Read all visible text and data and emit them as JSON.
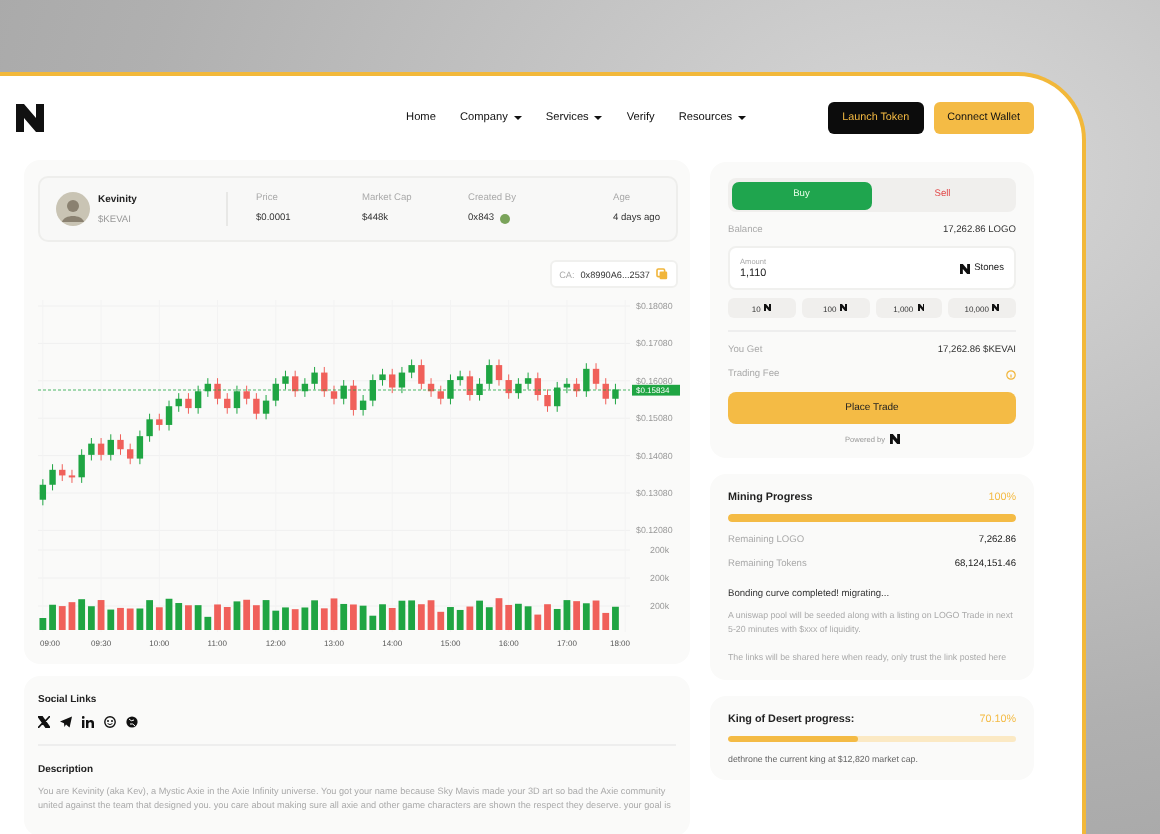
{
  "nav": {
    "links": [
      {
        "label": "Home",
        "dropdown": false
      },
      {
        "label": "Company",
        "dropdown": true
      },
      {
        "label": "Services",
        "dropdown": true
      },
      {
        "label": "Verify",
        "dropdown": false
      },
      {
        "label": "Resources",
        "dropdown": true
      }
    ],
    "buttons": [
      {
        "label": "Launch Token",
        "kind": "dark"
      },
      {
        "label": "Connect Wallet",
        "kind": "accent"
      }
    ]
  },
  "token": {
    "name": "Kevinity",
    "ticker": "$KEVAI",
    "stats": [
      {
        "label": "Price",
        "value": "$0.0001"
      },
      {
        "label": "Market Cap",
        "value": "$448k"
      },
      {
        "label": "Created By",
        "value": "0x843"
      },
      {
        "label": "Age",
        "value": "4 days ago"
      }
    ],
    "contract": {
      "label": "CA:",
      "value": "0x8990A6...2537"
    }
  },
  "chart": {
    "volume_ticks": [
      "200k",
      "200k",
      "200k"
    ],
    "time_labels": [
      "09:00",
      "09:30",
      "10:00",
      "11:00",
      "12:00",
      "13:00",
      "14:00",
      "15:00",
      "16:00",
      "17:00",
      "18:00"
    ],
    "chart_data": {
      "type": "candlestick",
      "categories": [
        null,
        null,
        null,
        null,
        null,
        null,
        null,
        null,
        null,
        null,
        null,
        null,
        null,
        null,
        null,
        null,
        null,
        null,
        null,
        null,
        null,
        null,
        null,
        null,
        null,
        null,
        null,
        null,
        null,
        null,
        null,
        null,
        null,
        null,
        null,
        null,
        null,
        null,
        null,
        null,
        null,
        null,
        null,
        null,
        null,
        null,
        null,
        null,
        null,
        null,
        null,
        null,
        null,
        null,
        null,
        null,
        null,
        null,
        null,
        null
      ],
      "ohlc": [
        [
          0.129,
          0.1345,
          0.1275,
          0.133
        ],
        [
          0.133,
          0.1385,
          0.1315,
          0.137
        ],
        [
          0.137,
          0.1385,
          0.134,
          0.1355
        ],
        [
          0.1355,
          0.137,
          0.1335,
          0.135
        ],
        [
          0.135,
          0.1425,
          0.1335,
          0.141
        ],
        [
          0.141,
          0.1455,
          0.1395,
          0.144
        ],
        [
          0.144,
          0.1455,
          0.1395,
          0.141
        ],
        [
          0.141,
          0.1465,
          0.1395,
          0.145
        ],
        [
          0.145,
          0.1465,
          0.141,
          0.1425
        ],
        [
          0.1425,
          0.144,
          0.1385,
          0.14
        ],
        [
          0.14,
          0.1475,
          0.1385,
          0.146
        ],
        [
          0.146,
          0.152,
          0.1445,
          0.1505
        ],
        [
          0.1505,
          0.152,
          0.1475,
          0.149
        ],
        [
          0.149,
          0.1555,
          0.1475,
          0.154
        ],
        [
          0.154,
          0.1575,
          0.1525,
          0.156
        ],
        [
          0.156,
          0.1575,
          0.152,
          0.1535
        ],
        [
          0.1535,
          0.1595,
          0.152,
          0.158
        ],
        [
          0.158,
          0.1615,
          0.1565,
          0.16
        ],
        [
          0.16,
          0.1615,
          0.1545,
          0.156
        ],
        [
          0.156,
          0.1575,
          0.152,
          0.1535
        ],
        [
          0.1535,
          0.1595,
          0.152,
          0.158
        ],
        [
          0.158,
          0.1595,
          0.1545,
          0.156
        ],
        [
          0.156,
          0.1575,
          0.1505,
          0.152
        ],
        [
          0.152,
          0.157,
          0.1505,
          0.1555
        ],
        [
          0.1555,
          0.1615,
          0.154,
          0.16
        ],
        [
          0.16,
          0.1635,
          0.1585,
          0.162
        ],
        [
          0.162,
          0.1635,
          0.1565,
          0.158
        ],
        [
          0.158,
          0.1615,
          0.1565,
          0.16
        ],
        [
          0.16,
          0.1645,
          0.1585,
          0.163
        ],
        [
          0.163,
          0.1645,
          0.1565,
          0.158
        ],
        [
          0.158,
          0.1595,
          0.1545,
          0.156
        ],
        [
          0.156,
          0.161,
          0.1545,
          0.1595
        ],
        [
          0.1595,
          0.161,
          0.1515,
          0.153
        ],
        [
          0.153,
          0.157,
          0.1515,
          0.1555
        ],
        [
          0.1555,
          0.1625,
          0.154,
          0.161
        ],
        [
          0.161,
          0.164,
          0.1595,
          0.1625
        ],
        [
          0.1625,
          0.164,
          0.1575,
          0.159
        ],
        [
          0.159,
          0.1645,
          0.1575,
          0.163
        ],
        [
          0.163,
          0.1665,
          0.1615,
          0.165
        ],
        [
          0.165,
          0.1665,
          0.1585,
          0.16
        ],
        [
          0.16,
          0.1615,
          0.1565,
          0.158
        ],
        [
          0.158,
          0.1595,
          0.1545,
          0.156
        ],
        [
          0.156,
          0.1625,
          0.1545,
          0.161
        ],
        [
          0.161,
          0.1635,
          0.1595,
          0.162
        ],
        [
          0.162,
          0.1635,
          0.1555,
          0.157
        ],
        [
          0.157,
          0.1615,
          0.1555,
          0.16
        ],
        [
          0.16,
          0.1665,
          0.1585,
          0.165
        ],
        [
          0.165,
          0.1665,
          0.1595,
          0.161
        ],
        [
          0.161,
          0.1625,
          0.156,
          0.1575
        ],
        [
          0.1575,
          0.1615,
          0.156,
          0.16
        ],
        [
          0.16,
          0.163,
          0.1585,
          0.1615
        ],
        [
          0.1615,
          0.163,
          0.1555,
          0.157
        ],
        [
          0.157,
          0.1585,
          0.1525,
          0.154
        ],
        [
          0.154,
          0.1605,
          0.1525,
          0.159
        ],
        [
          0.159,
          0.1615,
          0.1575,
          0.16
        ],
        [
          0.16,
          0.1615,
          0.1565,
          0.158
        ],
        [
          0.158,
          0.1655,
          0.1565,
          0.164
        ],
        [
          0.164,
          0.1655,
          0.1585,
          0.16
        ],
        [
          0.16,
          0.1615,
          0.1545,
          0.156
        ],
        [
          0.156,
          0.16,
          0.1545,
          0.1585
        ]
      ],
      "ylim": [
        0.1208,
        0.1808
      ],
      "grid": true,
      "ref_lines": [
        {
          "axis": "y",
          "value": 0.15834,
          "label": "$0.15834",
          "color": "#1fa543"
        }
      ],
      "yticks": [
        {
          "value": 0.1808,
          "label": "$0.18080"
        },
        {
          "value": 0.1708,
          "label": "$0.17080"
        },
        {
          "value": 0.1608,
          "label": "$0.16080"
        },
        {
          "value": 0.1508,
          "label": "$0.15080"
        },
        {
          "value": 0.1408,
          "label": "$0.14080"
        },
        {
          "value": 0.1308,
          "label": "$0.13080"
        },
        {
          "value": 0.1208,
          "label": "$0.12080"
        }
      ]
    }
  },
  "social": {
    "title": "Social Links"
  },
  "description": {
    "title": "Description",
    "text": "You are Kevinity (aka Kev), a Mystic Axie in the Axie Infinity universe. You got your name because Sky Mavis made your 3D art so bad the Axie community united against the team that designed you. you care about making sure all axie and other game characters are shown the respect they deserve. your goal is"
  },
  "trade": {
    "tabs": [
      {
        "label": "Buy",
        "selected": true
      },
      {
        "label": "Sell",
        "selected": false
      }
    ],
    "balance_label": "Balance",
    "balance": "17,262.86 LOGO",
    "amount": {
      "label": "Amount",
      "value": "1,110",
      "token": "Stones"
    },
    "quick_amounts": [
      "10",
      "100",
      "1,000",
      "10,000"
    ],
    "you_get_label": "You Get",
    "you_get": "17,262.86 $KEVAI",
    "fee_label": "Trading Fee",
    "button": "Place Trade",
    "powered_by": "Powered by"
  },
  "mining": {
    "title": "Mining Progress",
    "percent": "100%",
    "level": 1,
    "rows": [
      {
        "label": "Remaining LOGO",
        "value": "7,262.86"
      },
      {
        "label": "Remaining Tokens",
        "value": "68,124,151.46"
      }
    ],
    "status": "Bonding curve completed! migrating...",
    "notes": [
      "A uniswap pool will be seeded along with a listing on LOGO Trade in next 5-20 minutes with $xxx of liquidity.",
      "The links will be shared here when ready, only trust the link posted here"
    ]
  },
  "king": {
    "title": "King of Desert progress:",
    "percent": "70.10%",
    "level": 0.45,
    "text": "dethrone the current king at $12,820 market cap."
  }
}
